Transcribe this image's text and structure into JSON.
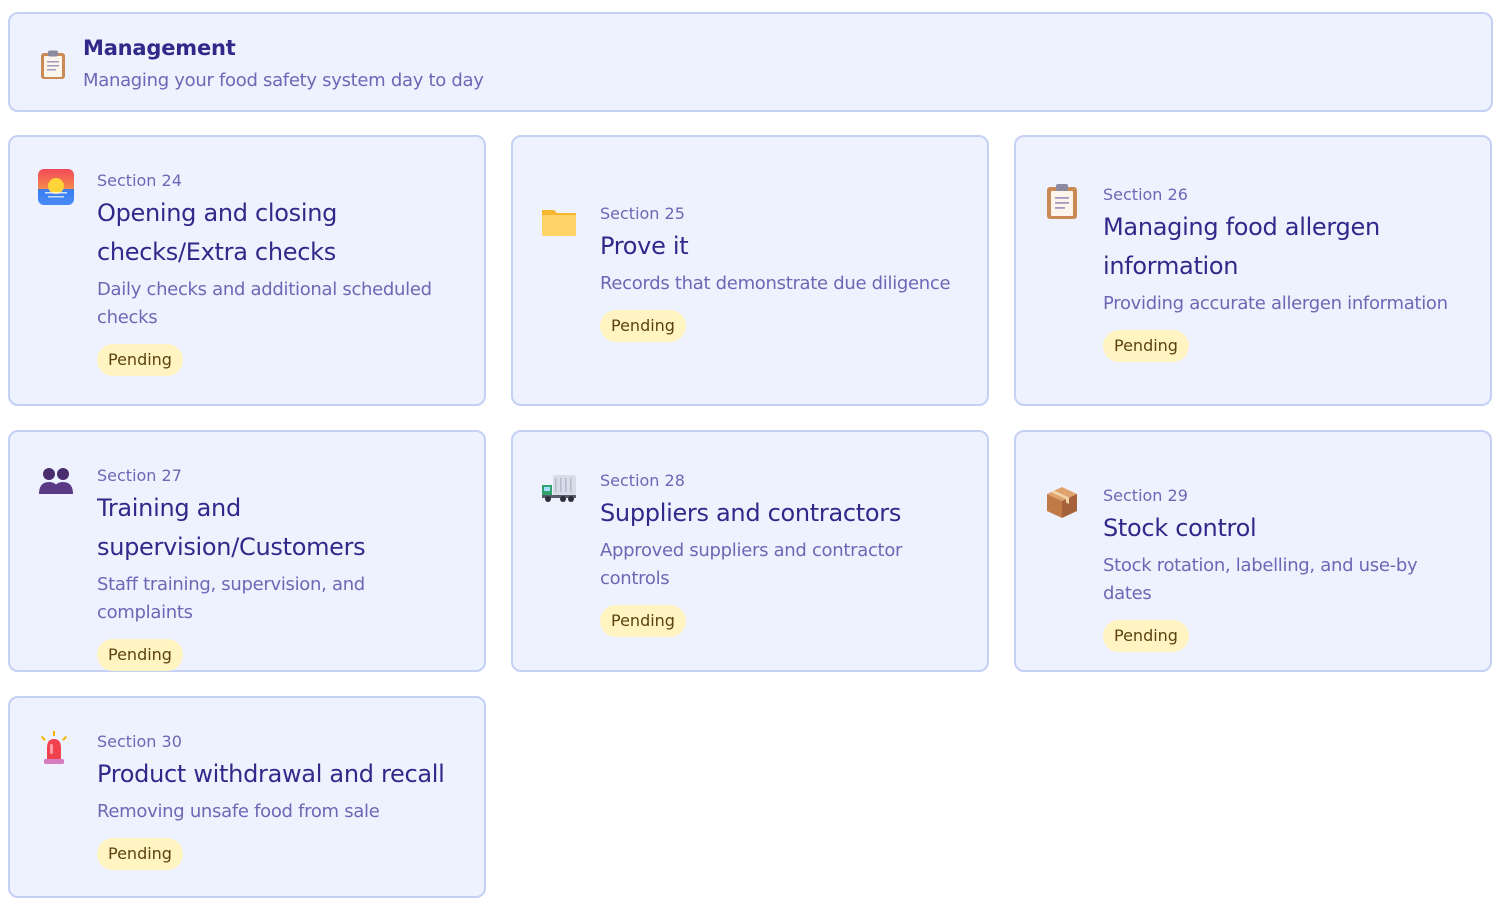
{
  "header": {
    "title": "Management",
    "subtitle": "Managing your food safety system day to day",
    "icon": "clipboard-icon"
  },
  "sections": [
    {
      "section_label": "Section 24",
      "title": "Opening and closing checks/Extra checks",
      "description": "Daily checks and additional scheduled checks",
      "status": "Pending",
      "icon": "sunrise-icon"
    },
    {
      "section_label": "Section 25",
      "title": "Prove it",
      "description": "Records that demonstrate due diligence",
      "status": "Pending",
      "icon": "folder-icon"
    },
    {
      "section_label": "Section 26",
      "title": "Managing food allergen information",
      "description": "Providing accurate allergen information",
      "status": "Pending",
      "icon": "clipboard-icon"
    },
    {
      "section_label": "Section 27",
      "title": "Training and supervision/Customers",
      "description": "Staff training, supervision, and complaints",
      "status": "Pending",
      "icon": "people-icon"
    },
    {
      "section_label": "Section 28",
      "title": "Suppliers and contractors",
      "description": "Approved suppliers and contractor controls",
      "status": "Pending",
      "icon": "truck-icon"
    },
    {
      "section_label": "Section 29",
      "title": "Stock control",
      "description": "Stock rotation, labelling, and use-by dates",
      "status": "Pending",
      "icon": "package-icon"
    },
    {
      "section_label": "Section 30",
      "title": "Product withdrawal and recall",
      "description": "Removing unsafe food from sale",
      "status": "Pending",
      "icon": "siren-icon"
    }
  ],
  "colors": {
    "card_bg": "#eef2fe",
    "card_border": "#c5d0f5",
    "title": "#2f2a8a",
    "muted": "#6d67b5",
    "badge_bg": "#fff4c2",
    "badge_text": "#5c4210"
  }
}
